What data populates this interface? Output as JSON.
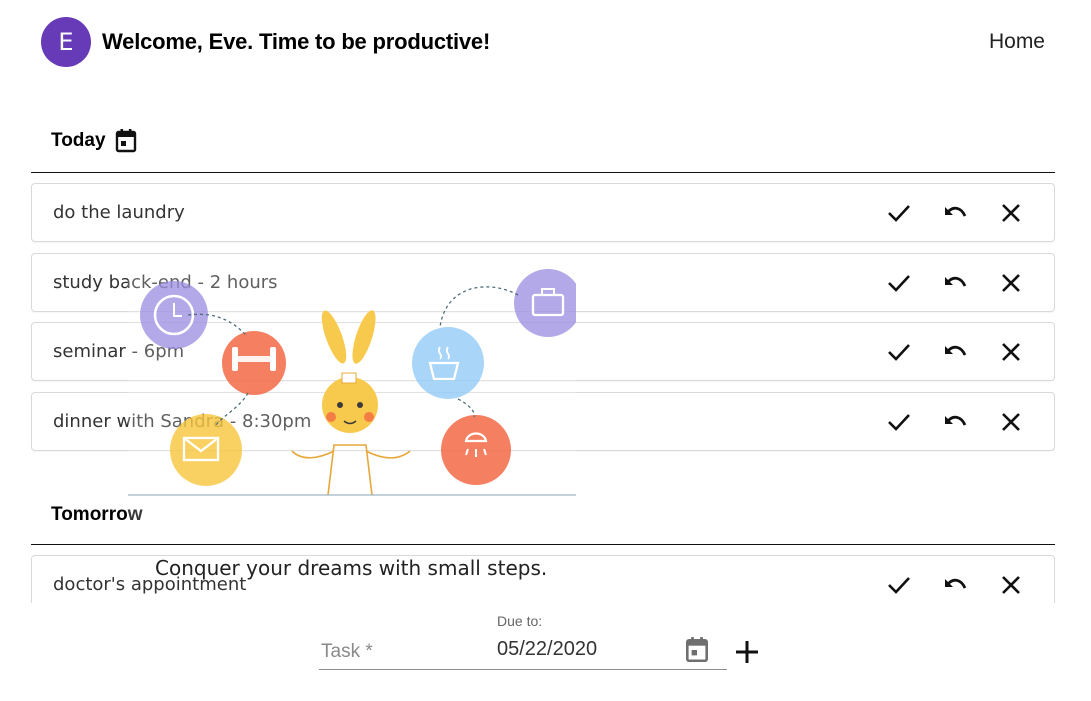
{
  "header": {
    "avatar_letter": "E",
    "welcome": "Welcome, Eve. Time to be productive!",
    "nav_home": "Home",
    "avatar_color": "#673ab7"
  },
  "sections": {
    "today": {
      "title": "Today"
    },
    "tomorrow": {
      "title": "Tomorrow"
    }
  },
  "tasks": {
    "today": [
      {
        "text": "do the laundry"
      },
      {
        "text": "study back-end - 2 hours"
      },
      {
        "text": "seminar - 6pm"
      },
      {
        "text": "dinner with Sandra - 8:30pm"
      }
    ],
    "tomorrow": [
      {
        "text": "doctor's appointment"
      }
    ]
  },
  "icons": {
    "complete": "check-icon",
    "undo": "undo-icon",
    "delete": "close-icon",
    "calendar": "calendar-icon",
    "add": "plus-icon"
  },
  "overlay": {
    "tagline": "Conquer your dreams with small steps."
  },
  "form": {
    "task_placeholder": "Task *",
    "task_value": "",
    "due_label": "Due to:",
    "due_value": "05/22/2020"
  }
}
